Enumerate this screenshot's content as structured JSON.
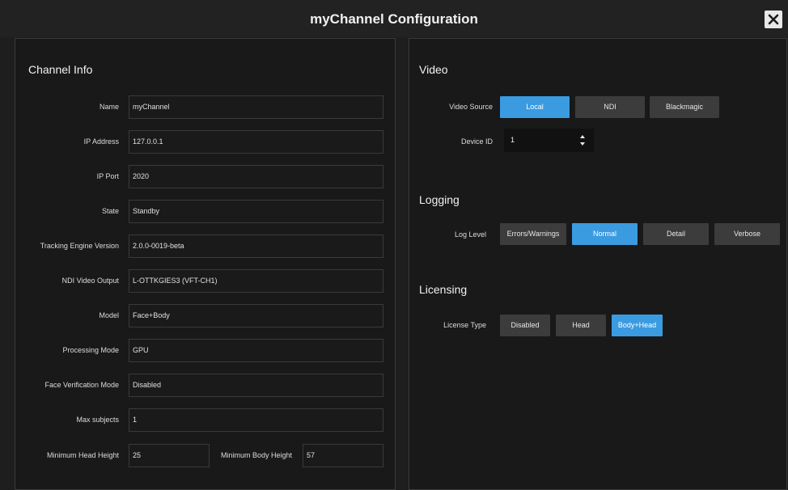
{
  "window": {
    "title": "myChannel Configuration"
  },
  "icons": {
    "close": "close-icon",
    "spinner_up": "chevron-up-icon",
    "spinner_down": "chevron-down-icon"
  },
  "colors": {
    "accent": "#3a9be1",
    "button": "#3c3c3c",
    "background": "#1e1e1e"
  },
  "channel_info": {
    "title": "Channel Info",
    "name": {
      "label": "Name",
      "value": "myChannel"
    },
    "ip_address": {
      "label": "IP Address",
      "value": "127.0.0.1"
    },
    "ip_port": {
      "label": "IP Port",
      "value": "2020"
    },
    "state": {
      "label": "State",
      "value": "Standby"
    },
    "tracking_engine": {
      "label": "Tracking Engine Version",
      "value": "2.0.0-0019-beta"
    },
    "ndi_output": {
      "label": "NDI Video Output",
      "value": "L-OTTKGIES3 (VFT-CH1)"
    },
    "model": {
      "label": "Model",
      "value": "Face+Body"
    },
    "processing_mode": {
      "label": "Processing Mode",
      "value": "GPU"
    },
    "face_verification": {
      "label": "Face Verification Mode",
      "value": "Disabled"
    },
    "max_subjects": {
      "label": "Max subjects",
      "value": "1"
    },
    "min_head_height": {
      "label": "Minimum Head Height",
      "value": "25"
    },
    "min_body_height": {
      "label": "Minimum Body Height",
      "value": "57"
    }
  },
  "video": {
    "title": "Video",
    "source_label": "Video Source",
    "source_options": [
      "Local",
      "NDI",
      "Blackmagic"
    ],
    "source_selected": "Local",
    "device_label": "Device ID",
    "device_value": "1"
  },
  "logging": {
    "title": "Logging",
    "level_label": "Log Level",
    "level_options": [
      "Errors/Warnings",
      "Normal",
      "Detail",
      "Verbose"
    ],
    "level_selected": "Normal"
  },
  "licensing": {
    "title": "Licensing",
    "type_label": "License Type",
    "type_options": [
      "Disabled",
      "Head",
      "Body+Head"
    ],
    "type_selected": "Body+Head"
  }
}
